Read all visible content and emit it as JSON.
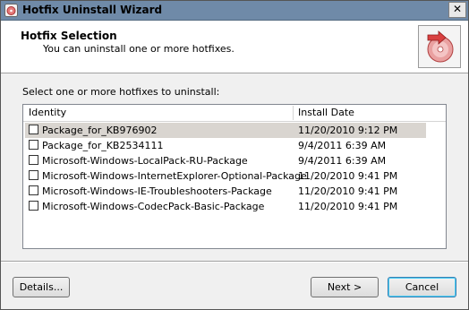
{
  "window": {
    "title": "Hotfix Uninstall Wizard",
    "close_glyph": "✕"
  },
  "header": {
    "title": "Hotfix Selection",
    "subtitle": "You can uninstall one or more hotfixes.",
    "icon": "uninstall-cd-icon"
  },
  "main": {
    "instruction": "Select one or more hotfixes to uninstall:",
    "columns": [
      "Identity",
      "Install Date"
    ],
    "rows": [
      {
        "identity": "Package_for_KB976902",
        "date": "11/20/2010 9:12 PM",
        "checked": false,
        "selected": true
      },
      {
        "identity": "Package_for_KB2534111",
        "date": "9/4/2011 6:39 AM",
        "checked": false,
        "selected": false
      },
      {
        "identity": "Microsoft-Windows-LocalPack-RU-Package",
        "date": "9/4/2011 6:39 AM",
        "checked": false,
        "selected": false
      },
      {
        "identity": "Microsoft-Windows-InternetExplorer-Optional-Package",
        "date": "11/20/2010 9:41 PM",
        "checked": false,
        "selected": false
      },
      {
        "identity": "Microsoft-Windows-IE-Troubleshooters-Package",
        "date": "11/20/2010 9:41 PM",
        "checked": false,
        "selected": false
      },
      {
        "identity": "Microsoft-Windows-CodecPack-Basic-Package",
        "date": "11/20/2010 9:41 PM",
        "checked": false,
        "selected": false
      }
    ]
  },
  "buttons": {
    "details": "Details...",
    "next": "Next >",
    "cancel": "Cancel"
  },
  "colors": {
    "titlebar": "#6f8aa8",
    "selected_row": "#d9d5d0",
    "dialog_bg": "#f0f0f0"
  }
}
